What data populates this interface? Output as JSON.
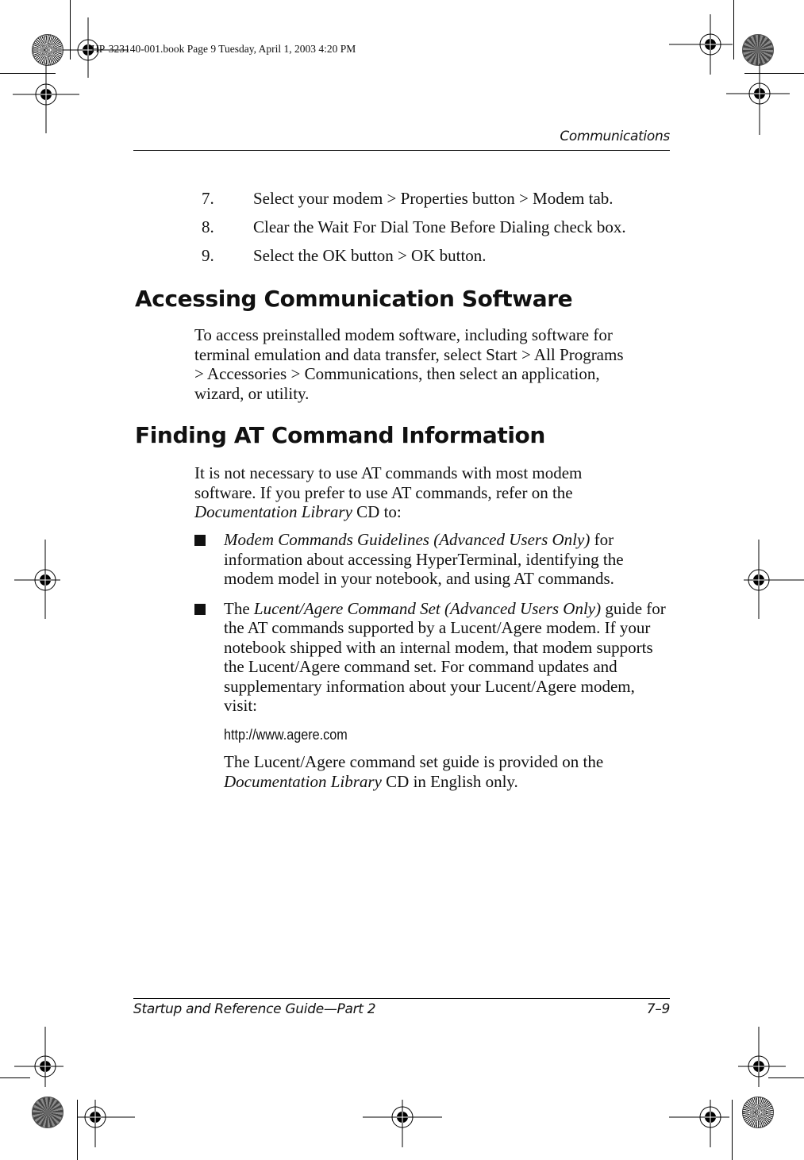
{
  "slug": "HP-323140-001.book  Page 9  Tuesday, April 1, 2003  4:20 PM",
  "running_head": "Communications",
  "steps": [
    {
      "num": "7.",
      "text": "Select your modem > Properties button > Modem tab."
    },
    {
      "num": "8.",
      "text": "Clear the Wait For Dial Tone Before Dialing check box."
    },
    {
      "num": "9.",
      "text": "Select the OK button > OK button."
    }
  ],
  "section1": {
    "heading": "Accessing Communication Software",
    "para": "To access preinstalled modem software, including software for terminal emulation and data transfer, select Start > All Programs > Accessories > Communications, then select an application, wizard, or utility."
  },
  "section2": {
    "heading": "Finding AT Command Information",
    "intro_a": "It is not necessary to use AT commands with most modem software. If you prefer to use AT commands, refer on the ",
    "intro_em": "Documentation Library",
    "intro_b": " CD to:",
    "bullets": [
      {
        "pre": "",
        "em": "Modem Commands Guidelines (Advanced Users Only)",
        "post": " for information about accessing HyperTerminal, identifying the modem model in your notebook, and using AT commands."
      },
      {
        "pre": "The ",
        "em": "Lucent/Agere Command Set (Advanced Users Only)",
        "post": " guide for the AT commands supported by a Lucent/Agere modem. If your notebook shipped with an internal modem, that modem supports the Lucent/Agere command set. For command updates and supplementary information about your Lucent/Agere modem, visit:",
        "url": "http://www.agere.com",
        "note_a": "The Lucent/Agere command set guide is provided on the ",
        "note_em": "Documentation Library",
        "note_b": " CD in English only."
      }
    ]
  },
  "footer": {
    "title": "Startup and Reference Guide—Part 2",
    "page": "7–9"
  }
}
